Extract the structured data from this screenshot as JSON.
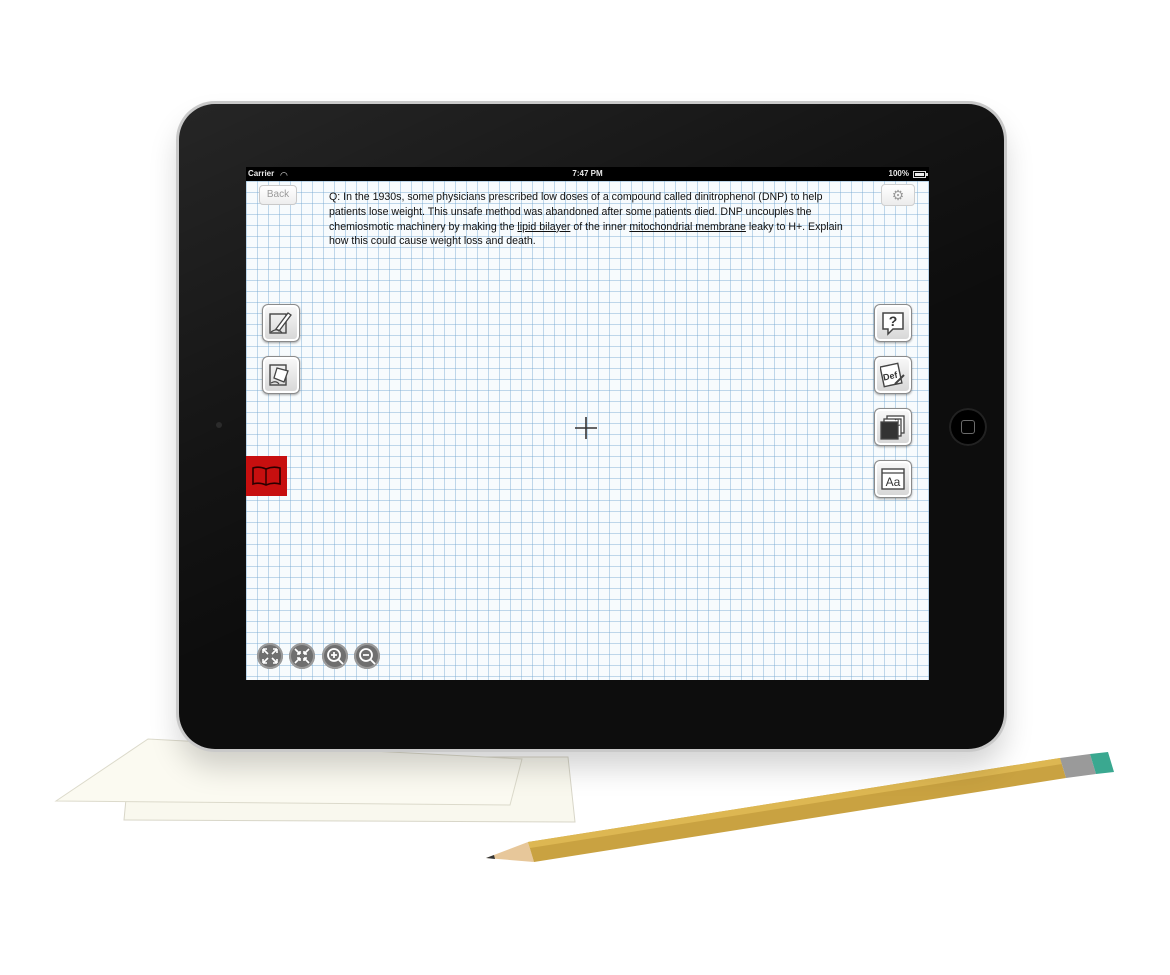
{
  "status_bar": {
    "carrier": "Carrier",
    "time": "7:47 PM",
    "battery": "100%"
  },
  "navigation": {
    "back_label": "Back"
  },
  "question": {
    "part1": "Q: In the 1930s, some physicians prescribed low doses of a compound called dinitrophenol (DNP) to help patients lose weight. This unsafe method was abandoned after some patients died. DNP uncouples the chemiosmotic machinery by making the ",
    "link1": "lipid bilayer",
    "part2": " of the inner ",
    "link2": "mitochondrial membrane",
    "part3": " leaky to H+. Explain how this could cause weight loss and death."
  },
  "icons": {
    "left_tools": [
      "pen-icon",
      "eraser-icon"
    ],
    "right_tools": [
      "help-icon",
      "definition-icon",
      "drawing-pages-icon",
      "text-size-icon"
    ],
    "zoom_controls": [
      "expand-icon",
      "shrink-icon",
      "zoom-in-icon",
      "zoom-out-icon"
    ],
    "side_tab": "book-icon"
  },
  "colors": {
    "book_tab": "#c70f0f",
    "grid_line": "#78aad2",
    "bezel": "#0d0d0d"
  }
}
